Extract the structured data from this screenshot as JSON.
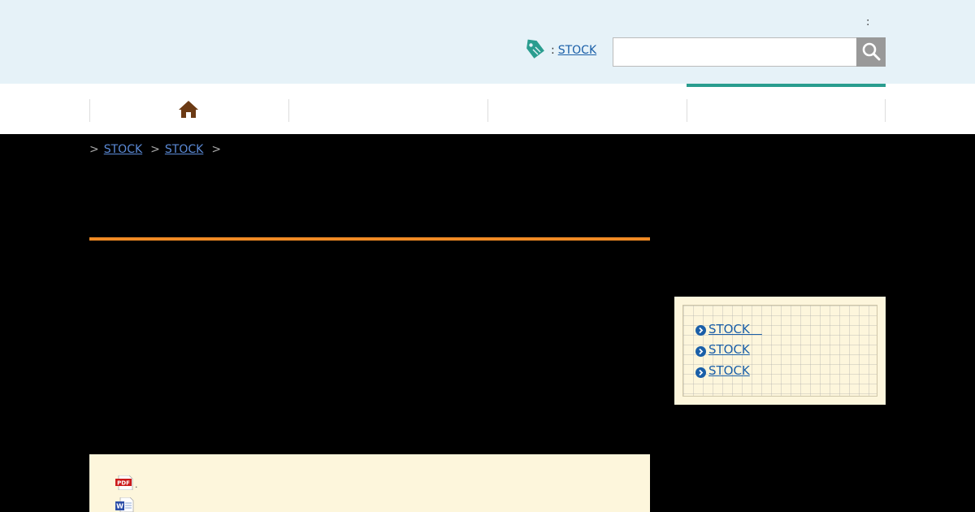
{
  "header": {
    "colon_text": ":",
    "tag_separator": ":",
    "tag_link": "STOCK",
    "search": {
      "value": "",
      "placeholder": ""
    }
  },
  "nav": {
    "items": [
      "home",
      "",
      "",
      ""
    ],
    "active_index": 3,
    "accent_color": "#2a9d8f"
  },
  "breadcrumb": {
    "lead_separator": ">",
    "items": [
      "STOCK",
      "STOCK"
    ],
    "separator": ">"
  },
  "side_links": {
    "items": [
      "STOCK　",
      "STOCK",
      "STOCK"
    ],
    "icon": "chevron-circle-right-icon"
  },
  "files": {
    "items": [
      {
        "icon": "pdf-file-icon",
        "label": "PDF",
        "suffix": "."
      },
      {
        "icon": "word-file-icon",
        "label": "W",
        "suffix": ""
      }
    ]
  },
  "colors": {
    "header_bg": "#e6f2f8",
    "accent_orange": "#f08a24",
    "link_blue": "#1a5fa8",
    "box_bg": "#fdf6dc"
  }
}
